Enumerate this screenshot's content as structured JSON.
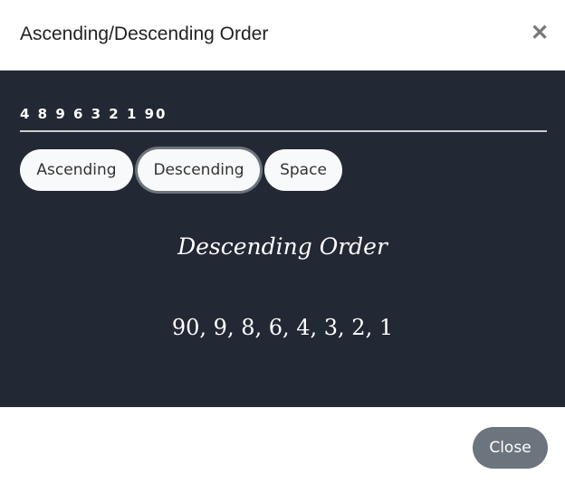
{
  "modal": {
    "title": "Ascending/Descending Order",
    "close_icon": "close-icon"
  },
  "input": {
    "value": "4 8 9 6 3 2 1 90"
  },
  "buttons": {
    "ascending": "Ascending",
    "descending": "Descending",
    "space": "Space",
    "active": "Descending"
  },
  "result": {
    "title": "Descending Order",
    "values": "90, 9, 8, 6, 4, 3, 2, 1"
  },
  "footer": {
    "close_label": "Close"
  },
  "colors": {
    "panel": "#222834",
    "close_button": "#6c757d"
  }
}
